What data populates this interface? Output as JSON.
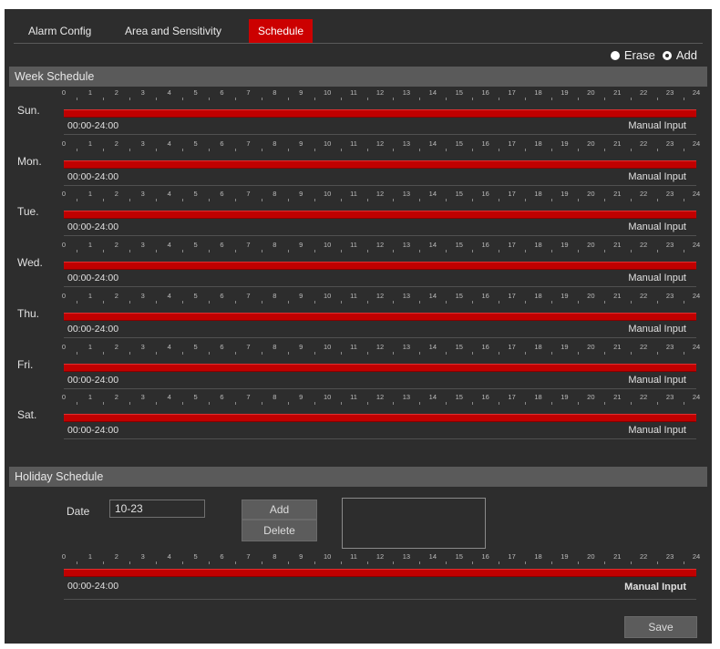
{
  "tabs": [
    {
      "label": "Alarm Config",
      "active": false
    },
    {
      "label": "Area and Sensitivity",
      "active": false
    },
    {
      "label": "Schedule",
      "active": true
    }
  ],
  "mode": {
    "erase_label": "Erase",
    "add_label": "Add",
    "selected": "Add"
  },
  "week_schedule": {
    "title": "Week Schedule",
    "hours": [
      "0",
      "1",
      "2",
      "3",
      "4",
      "5",
      "6",
      "7",
      "8",
      "9",
      "10",
      "11",
      "12",
      "13",
      "14",
      "15",
      "16",
      "17",
      "18",
      "19",
      "20",
      "21",
      "22",
      "23",
      "24"
    ],
    "days": [
      {
        "label": "Sun.",
        "range": "00:00-24:00",
        "manual": "Manual Input"
      },
      {
        "label": "Mon.",
        "range": "00:00-24:00",
        "manual": "Manual Input"
      },
      {
        "label": "Tue.",
        "range": "00:00-24:00",
        "manual": "Manual Input"
      },
      {
        "label": "Wed.",
        "range": "00:00-24:00",
        "manual": "Manual Input"
      },
      {
        "label": "Thu.",
        "range": "00:00-24:00",
        "manual": "Manual Input"
      },
      {
        "label": "Fri.",
        "range": "00:00-24:00",
        "manual": "Manual Input"
      },
      {
        "label": "Sat.",
        "range": "00:00-24:00",
        "manual": "Manual Input"
      }
    ]
  },
  "holiday_schedule": {
    "title": "Holiday Schedule",
    "date_label": "Date",
    "date_value": "10-23",
    "add_label": "Add",
    "delete_label": "Delete",
    "range": "00:00-24:00",
    "manual": "Manual Input"
  },
  "save_label": "Save",
  "colors": {
    "accent": "#cc0000",
    "bar": "#c00000",
    "background": "#2d2d2d",
    "header": "#5a5a5a"
  }
}
